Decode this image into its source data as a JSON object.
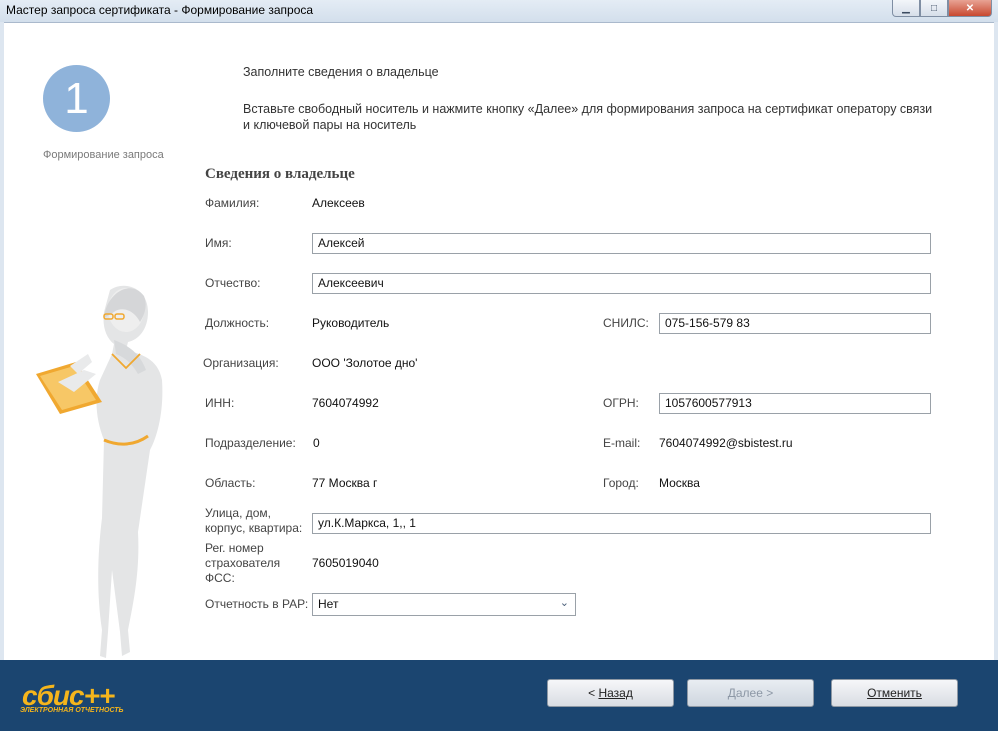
{
  "window": {
    "title": "Мастер запроса сертификата - Формирование запроса",
    "min_glyph": "▁",
    "max_glyph": "□",
    "close_glyph": "✕"
  },
  "step": {
    "number": "1",
    "label": "Формирование запроса"
  },
  "instructions": {
    "line1": "Заполните сведения о владельце",
    "line2": "Вставьте свободный носитель и нажмите кнопку «Далее» для формирования запроса на сертификат оператору связи и ключевой пары на носитель"
  },
  "section_title": "Сведения о владельце",
  "form": {
    "surname_label": "Фамилия:",
    "surname_value": "Алексеев",
    "name_label": "Имя:",
    "name_value": "Алексей",
    "patronymic_label": "Отчество:",
    "patronymic_value": "Алексеевич",
    "position_label": "Должность:",
    "position_value": "Руководитель",
    "snils_label": "СНИЛС:",
    "snils_value": "075-156-579 83",
    "org_label": "Организация:",
    "org_value": "ООО 'Золотое дно'",
    "inn_label": "ИНН:",
    "inn_value": "7604074992",
    "ogrn_label": "ОГРН:",
    "ogrn_value": "1057600577913",
    "dept_label": "Подразделение:",
    "dept_value": "0",
    "email_label": "E-mail:",
    "email_value": "7604074992@sbistest.ru",
    "region_label": "Область:",
    "region_value": "77 Москва г",
    "city_label": "Город:",
    "city_value": "Москва",
    "street_label": "Улица, дом, корпус, квартира:",
    "street_value": "ул.К.Маркса, 1,, 1",
    "fss_label": "Рег. номер страхователя ФСС:",
    "fss_value": "7605019040",
    "rar_label": "Отчетность в РАР:",
    "rar_value": "Нет"
  },
  "footer": {
    "logo_text": "сбис++",
    "logo_subtitle": "ЭЛЕКТРОННАЯ ОТЧЕТНОСТЬ",
    "back_prefix": "< ",
    "back_label": "Назад",
    "next_label": "Далее >",
    "cancel_label": "Отменить"
  },
  "colors": {
    "footer_bg": "#1b4570",
    "accent": "#f5b51c",
    "step_circle": "#8fb3da"
  }
}
